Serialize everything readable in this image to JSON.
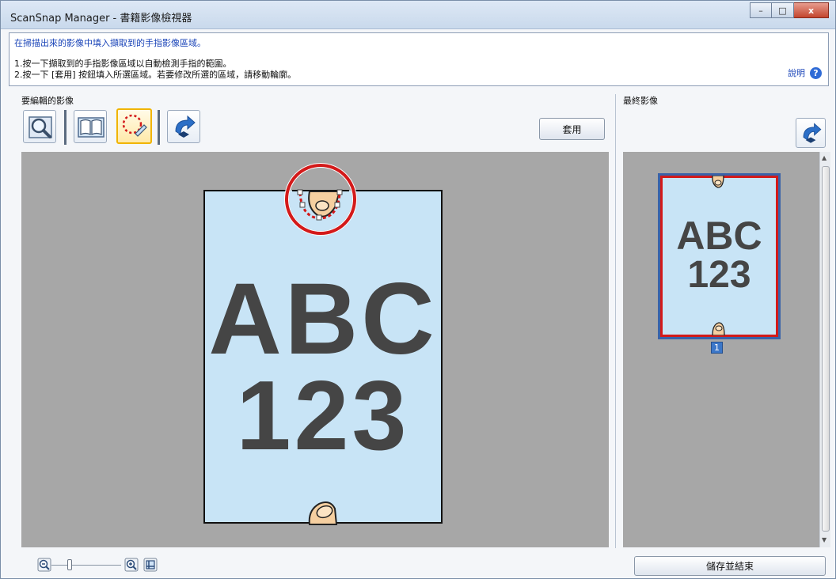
{
  "window": {
    "title": "ScanSnap Manager - 書籍影像檢視器",
    "buttons": {
      "minimize": "–",
      "maximize": "□",
      "close": "x"
    }
  },
  "instructions": {
    "heading": "在掃描出來的影像中填入擷取到的手指影像區域。",
    "step1": "1.按一下擷取到的手指影像區域以自動檢測手指的範圍。",
    "step2": "2.按一下 [套用] 按鈕填入所選區域。若要修改所選的區域，請移動輪廓。",
    "help_label": "說明",
    "help_icon": "?"
  },
  "edit_panel": {
    "label": "要編輯的影像",
    "apply_label": "套用",
    "page": {
      "line1": "ABC",
      "line2": "123",
      "bg_color": "#c8e4f6",
      "text_color": "#454545"
    },
    "highlight_color": "#d31a1a"
  },
  "final_panel": {
    "label": "最終影像",
    "thumbnail": {
      "line1": "ABC",
      "line2": "123"
    },
    "page_number": "1"
  },
  "footer": {
    "save_label": "儲存並結束"
  }
}
